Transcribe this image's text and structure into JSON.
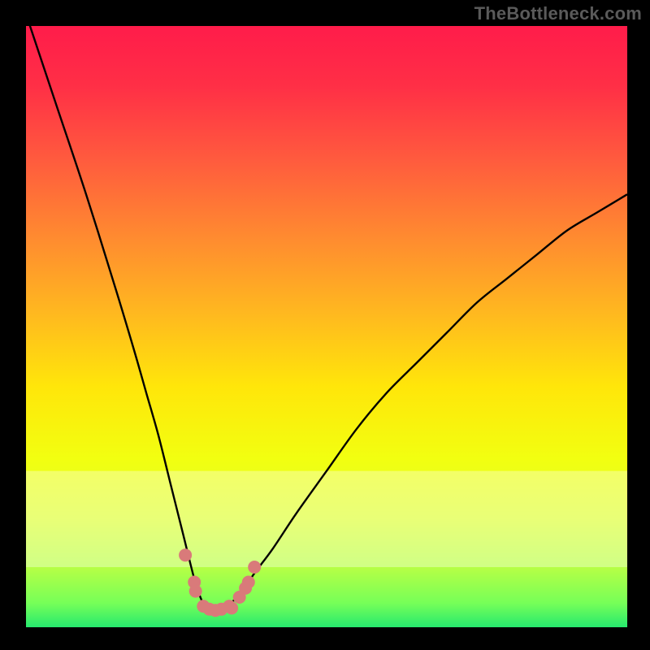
{
  "watermark": "TheBottleneck.com",
  "chart_data": {
    "type": "line",
    "title": "",
    "xlabel": "",
    "ylabel": "",
    "xlim": [
      0,
      100
    ],
    "ylim": [
      0,
      100
    ],
    "annotations": [],
    "series": [
      {
        "name": "valley-curve",
        "x": [
          0,
          5,
          10,
          15,
          18,
          20,
          22,
          24,
          26,
          28,
          29,
          30,
          31,
          32,
          34,
          36,
          38,
          41,
          45,
          50,
          55,
          60,
          65,
          70,
          75,
          80,
          85,
          90,
          95,
          100
        ],
        "y": [
          102,
          87,
          72,
          56,
          46,
          39,
          32,
          24,
          16,
          8,
          5,
          3,
          3,
          3,
          4,
          6,
          9,
          13,
          19,
          26,
          33,
          39,
          44,
          49,
          54,
          58,
          62,
          66,
          69,
          72
        ]
      }
    ],
    "markers": {
      "name": "valley-markers",
      "x": [
        26.5,
        28,
        28.2,
        29.5,
        30.5,
        31.5,
        32.5,
        33.8,
        34.2,
        35.5,
        36.5,
        37,
        38
      ],
      "y": [
        12,
        7.5,
        6,
        3.5,
        3,
        2.8,
        3,
        3.5,
        3.2,
        5,
        6.5,
        7.5,
        10
      ]
    },
    "background_gradient": {
      "stops": [
        {
          "offset": 0.0,
          "color": "#ff1c4a"
        },
        {
          "offset": 0.1,
          "color": "#ff2f46"
        },
        {
          "offset": 0.22,
          "color": "#ff5a3e"
        },
        {
          "offset": 0.35,
          "color": "#ff8a30"
        },
        {
          "offset": 0.48,
          "color": "#ffb91f"
        },
        {
          "offset": 0.6,
          "color": "#ffe60a"
        },
        {
          "offset": 0.72,
          "color": "#f2ff10"
        },
        {
          "offset": 0.82,
          "color": "#ddff2e"
        },
        {
          "offset": 0.9,
          "color": "#b7ff45"
        },
        {
          "offset": 0.96,
          "color": "#76ff58"
        },
        {
          "offset": 1.0,
          "color": "#26e96e"
        }
      ]
    },
    "pale_band": {
      "y0": 74,
      "y1": 90,
      "opacity": 0.35
    },
    "curve_color": "#000000",
    "marker_color": "#d97a7a",
    "marker_radius": 8
  }
}
